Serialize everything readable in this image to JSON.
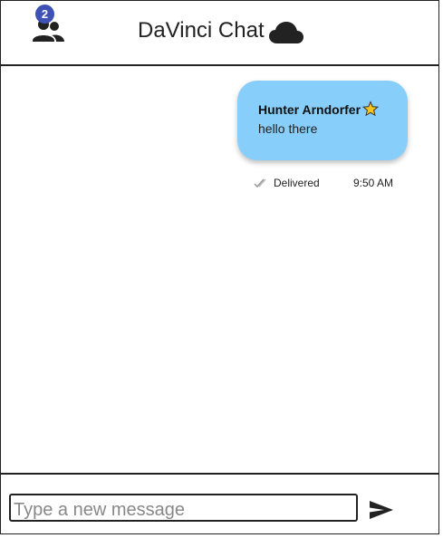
{
  "header": {
    "title": "DaVinci Chat",
    "users_badge_count": "2",
    "users_icon": "users-icon",
    "status_icon": "cloud-icon"
  },
  "messages": [
    {
      "sender": "Hunter Arndorfer",
      "sender_icon": "star-icon",
      "text": "hello there",
      "status": "Delivered",
      "status_icon": "check-icon",
      "time": "9:50 AM"
    }
  ],
  "composer": {
    "placeholder": "Type a new message",
    "value": "",
    "send_icon": "send-icon"
  },
  "colors": {
    "bubble": "#87cefa",
    "badge": "#3f51b5",
    "star": "#f5c518"
  }
}
